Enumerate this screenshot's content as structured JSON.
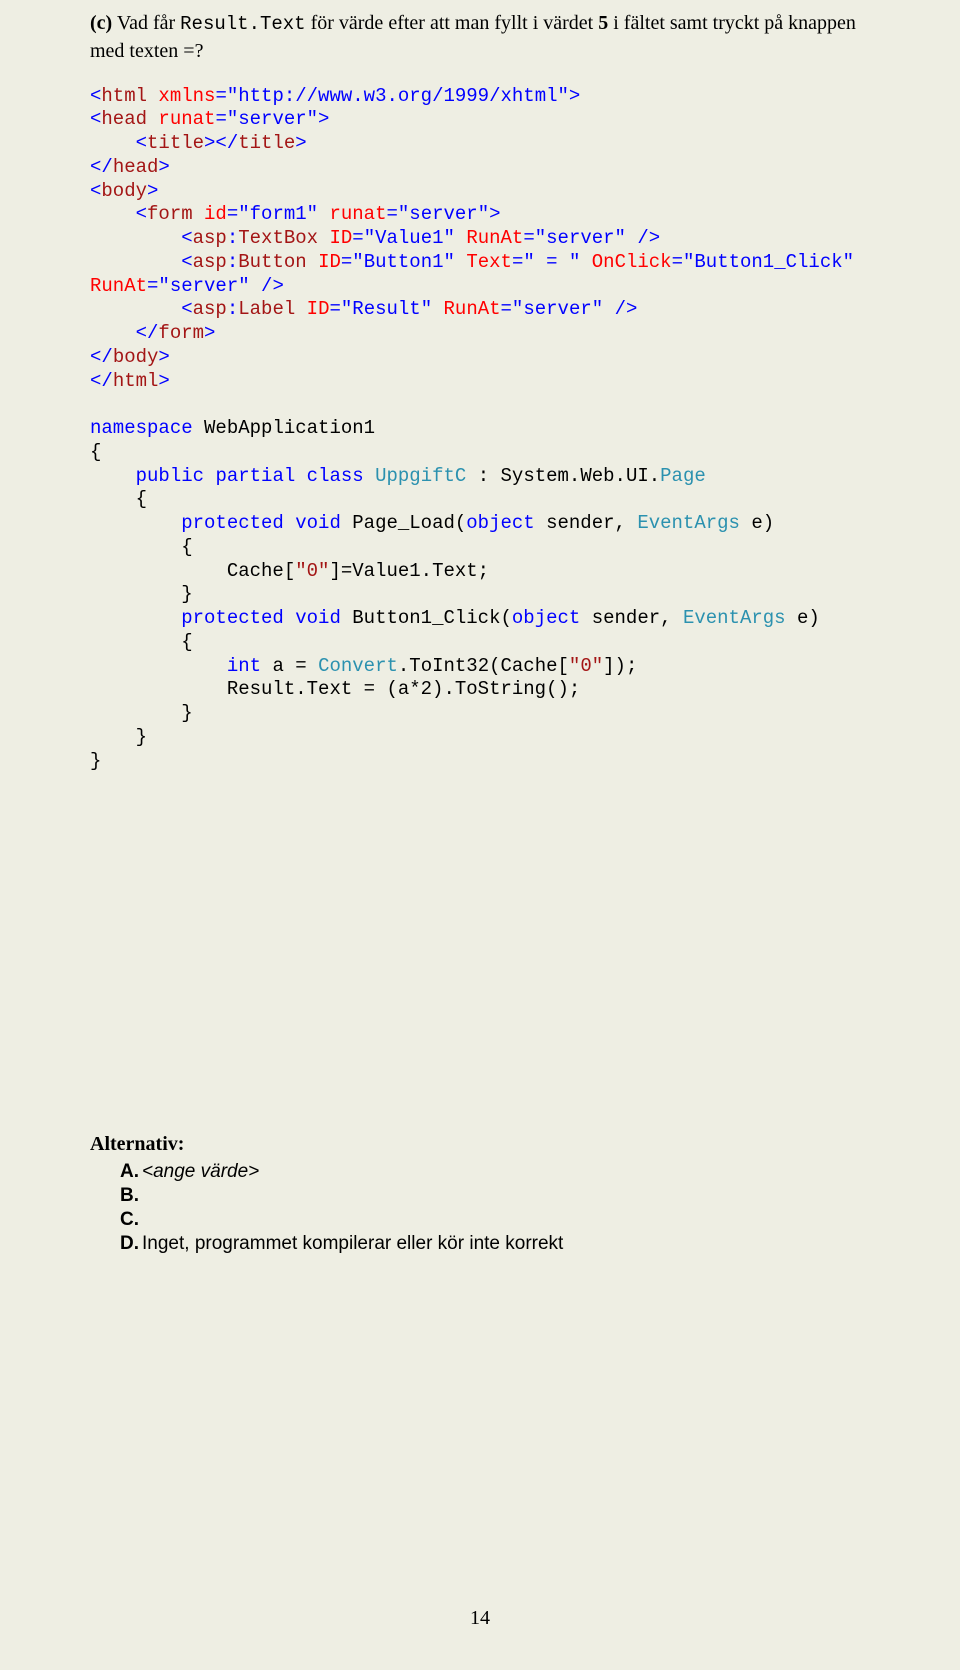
{
  "question": {
    "label": "(c)",
    "text_before_mono": " Vad får ",
    "mono_text": "Result.Text",
    "text_after_mono": " för värde efter att man fyllt i värdet ",
    "bold_value": "5",
    "text_rest": " i fältet samt tryckt på knappen med texten =?"
  },
  "code": {
    "tokens": [
      [
        {
          "t": "<",
          "c": "blue"
        },
        {
          "t": "html",
          "c": "maroon"
        },
        {
          "t": " ",
          "c": "black"
        },
        {
          "t": "xmlns",
          "c": "red"
        },
        {
          "t": "=\"http://www.w3.org/1999/xhtml\">",
          "c": "blue"
        }
      ],
      [
        {
          "t": "<",
          "c": "blue"
        },
        {
          "t": "head",
          "c": "maroon"
        },
        {
          "t": " ",
          "c": "black"
        },
        {
          "t": "runat",
          "c": "red"
        },
        {
          "t": "=\"server\">",
          "c": "blue"
        }
      ],
      [
        {
          "t": "    ",
          "c": "black"
        },
        {
          "t": "<",
          "c": "blue"
        },
        {
          "t": "title",
          "c": "maroon"
        },
        {
          "t": "></",
          "c": "blue"
        },
        {
          "t": "title",
          "c": "maroon"
        },
        {
          "t": ">",
          "c": "blue"
        }
      ],
      [
        {
          "t": "</",
          "c": "blue"
        },
        {
          "t": "head",
          "c": "maroon"
        },
        {
          "t": ">",
          "c": "blue"
        }
      ],
      [
        {
          "t": "<",
          "c": "blue"
        },
        {
          "t": "body",
          "c": "maroon"
        },
        {
          "t": ">",
          "c": "blue"
        }
      ],
      [
        {
          "t": "    ",
          "c": "black"
        },
        {
          "t": "<",
          "c": "blue"
        },
        {
          "t": "form",
          "c": "maroon"
        },
        {
          "t": " ",
          "c": "black"
        },
        {
          "t": "id",
          "c": "red"
        },
        {
          "t": "=\"form1\"",
          "c": "blue"
        },
        {
          "t": " ",
          "c": "black"
        },
        {
          "t": "runat",
          "c": "red"
        },
        {
          "t": "=\"server\">",
          "c": "blue"
        }
      ],
      [
        {
          "t": "        ",
          "c": "black"
        },
        {
          "t": "<",
          "c": "blue"
        },
        {
          "t": "asp",
          "c": "maroon"
        },
        {
          "t": ":",
          "c": "blue"
        },
        {
          "t": "TextBox",
          "c": "maroon"
        },
        {
          "t": " ",
          "c": "black"
        },
        {
          "t": "ID",
          "c": "red"
        },
        {
          "t": "=\"Value1\"",
          "c": "blue"
        },
        {
          "t": " ",
          "c": "black"
        },
        {
          "t": "RunAt",
          "c": "red"
        },
        {
          "t": "=\"server\"",
          "c": "blue"
        },
        {
          "t": " ",
          "c": "black"
        },
        {
          "t": "/>",
          "c": "blue"
        }
      ],
      [
        {
          "t": "        ",
          "c": "black"
        },
        {
          "t": "<",
          "c": "blue"
        },
        {
          "t": "asp",
          "c": "maroon"
        },
        {
          "t": ":",
          "c": "blue"
        },
        {
          "t": "Button",
          "c": "maroon"
        },
        {
          "t": " ",
          "c": "black"
        },
        {
          "t": "ID",
          "c": "red"
        },
        {
          "t": "=\"Button1\"",
          "c": "blue"
        },
        {
          "t": " ",
          "c": "black"
        },
        {
          "t": "Text",
          "c": "red"
        },
        {
          "t": "=\" = \"",
          "c": "blue"
        },
        {
          "t": " ",
          "c": "black"
        },
        {
          "t": "OnClick",
          "c": "red"
        },
        {
          "t": "=\"Button1_Click\"",
          "c": "blue"
        }
      ],
      [
        {
          "t": "RunAt",
          "c": "red"
        },
        {
          "t": "=\"server\"",
          "c": "blue"
        },
        {
          "t": " ",
          "c": "black"
        },
        {
          "t": "/>",
          "c": "blue"
        }
      ],
      [
        {
          "t": "        ",
          "c": "black"
        },
        {
          "t": "<",
          "c": "blue"
        },
        {
          "t": "asp",
          "c": "maroon"
        },
        {
          "t": ":",
          "c": "blue"
        },
        {
          "t": "Label",
          "c": "maroon"
        },
        {
          "t": " ",
          "c": "black"
        },
        {
          "t": "ID",
          "c": "red"
        },
        {
          "t": "=\"Result\"",
          "c": "blue"
        },
        {
          "t": " ",
          "c": "black"
        },
        {
          "t": "RunAt",
          "c": "red"
        },
        {
          "t": "=\"server\"",
          "c": "blue"
        },
        {
          "t": " ",
          "c": "black"
        },
        {
          "t": "/>",
          "c": "blue"
        }
      ],
      [
        {
          "t": "    ",
          "c": "black"
        },
        {
          "t": "</",
          "c": "blue"
        },
        {
          "t": "form",
          "c": "maroon"
        },
        {
          "t": ">",
          "c": "blue"
        }
      ],
      [
        {
          "t": "</",
          "c": "blue"
        },
        {
          "t": "body",
          "c": "maroon"
        },
        {
          "t": ">",
          "c": "blue"
        }
      ],
      [
        {
          "t": "</",
          "c": "blue"
        },
        {
          "t": "html",
          "c": "maroon"
        },
        {
          "t": ">",
          "c": "blue"
        }
      ],
      [],
      [
        {
          "t": "namespace",
          "c": "blue"
        },
        {
          "t": " WebApplication1",
          "c": "black"
        }
      ],
      [
        {
          "t": "{",
          "c": "black"
        }
      ],
      [
        {
          "t": "    ",
          "c": "black"
        },
        {
          "t": "public",
          "c": "blue"
        },
        {
          "t": " ",
          "c": "black"
        },
        {
          "t": "partial",
          "c": "blue"
        },
        {
          "t": " ",
          "c": "black"
        },
        {
          "t": "class",
          "c": "blue"
        },
        {
          "t": " ",
          "c": "black"
        },
        {
          "t": "UppgiftC",
          "c": "teal"
        },
        {
          "t": " : System.Web.UI.",
          "c": "black"
        },
        {
          "t": "Page",
          "c": "teal"
        }
      ],
      [
        {
          "t": "    {",
          "c": "black"
        }
      ],
      [
        {
          "t": "        ",
          "c": "black"
        },
        {
          "t": "protected",
          "c": "blue"
        },
        {
          "t": " ",
          "c": "black"
        },
        {
          "t": "void",
          "c": "blue"
        },
        {
          "t": " Page_Load(",
          "c": "black"
        },
        {
          "t": "object",
          "c": "blue"
        },
        {
          "t": " sender, ",
          "c": "black"
        },
        {
          "t": "EventArgs",
          "c": "teal"
        },
        {
          "t": " e)",
          "c": "black"
        }
      ],
      [
        {
          "t": "        {",
          "c": "black"
        }
      ],
      [
        {
          "t": "            Cache[",
          "c": "black"
        },
        {
          "t": "\"0\"",
          "c": "maroon"
        },
        {
          "t": "]=Value1.Text;",
          "c": "black"
        }
      ],
      [
        {
          "t": "        }",
          "c": "black"
        }
      ],
      [
        {
          "t": "        ",
          "c": "black"
        },
        {
          "t": "protected",
          "c": "blue"
        },
        {
          "t": " ",
          "c": "black"
        },
        {
          "t": "void",
          "c": "blue"
        },
        {
          "t": " Button1_Click(",
          "c": "black"
        },
        {
          "t": "object",
          "c": "blue"
        },
        {
          "t": " sender, ",
          "c": "black"
        },
        {
          "t": "EventArgs",
          "c": "teal"
        },
        {
          "t": " e)",
          "c": "black"
        }
      ],
      [
        {
          "t": "        {",
          "c": "black"
        }
      ],
      [
        {
          "t": "            ",
          "c": "black"
        },
        {
          "t": "int",
          "c": "blue"
        },
        {
          "t": " a = ",
          "c": "black"
        },
        {
          "t": "Convert",
          "c": "teal"
        },
        {
          "t": ".ToInt32(Cache[",
          "c": "black"
        },
        {
          "t": "\"0\"",
          "c": "maroon"
        },
        {
          "t": "]);",
          "c": "black"
        }
      ],
      [
        {
          "t": "            Result.Text = (a*2).ToString();",
          "c": "black"
        }
      ],
      [
        {
          "t": "        }",
          "c": "black"
        }
      ],
      [
        {
          "t": "    }",
          "c": "black"
        }
      ],
      [
        {
          "t": "}",
          "c": "black"
        }
      ]
    ]
  },
  "alternatives": {
    "heading": "Alternativ:",
    "items": [
      {
        "label": "A.",
        "text": "<ange värde>",
        "italic": true
      },
      {
        "label": "B.",
        "text": "",
        "italic": false
      },
      {
        "label": "C.",
        "text": "",
        "italic": false
      },
      {
        "label": "D.",
        "text": "Inget, programmet kompilerar eller kör inte korrekt",
        "italic": false
      }
    ]
  },
  "page_number": "14"
}
